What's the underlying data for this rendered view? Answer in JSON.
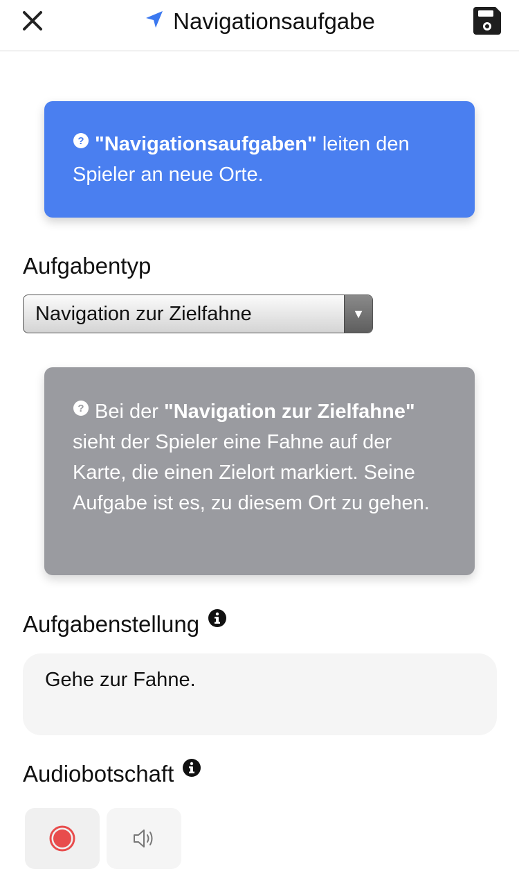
{
  "header": {
    "title": "Navigationsaufgabe",
    "icons": {
      "close": "close-icon",
      "nav": "navigation-arrow-icon",
      "save": "floppy-disk-icon"
    }
  },
  "info_blue": {
    "strong": "\"Navigationsaufgaben\"",
    "text": " leiten den Spieler an neue Orte.",
    "color": "#4a7ff0"
  },
  "task_type": {
    "label": "Aufgabentyp",
    "selected": "Navigation zur Zielfahne"
  },
  "info_grey": {
    "prefix": "Bei der ",
    "strong": "\"Navigation zur Zielfahne\"",
    "text": " sieht der Spieler eine Fahne auf der Karte, die einen Zielort markiert. Seine Aufgabe ist es, zu diesem Ort zu gehen.",
    "color": "#9a9ba0"
  },
  "assignment": {
    "label": "Aufgabenstellung",
    "value": "Gehe zur Fahne."
  },
  "audio": {
    "label": "Audiobotschaft",
    "record_color": "#e84c4c"
  }
}
